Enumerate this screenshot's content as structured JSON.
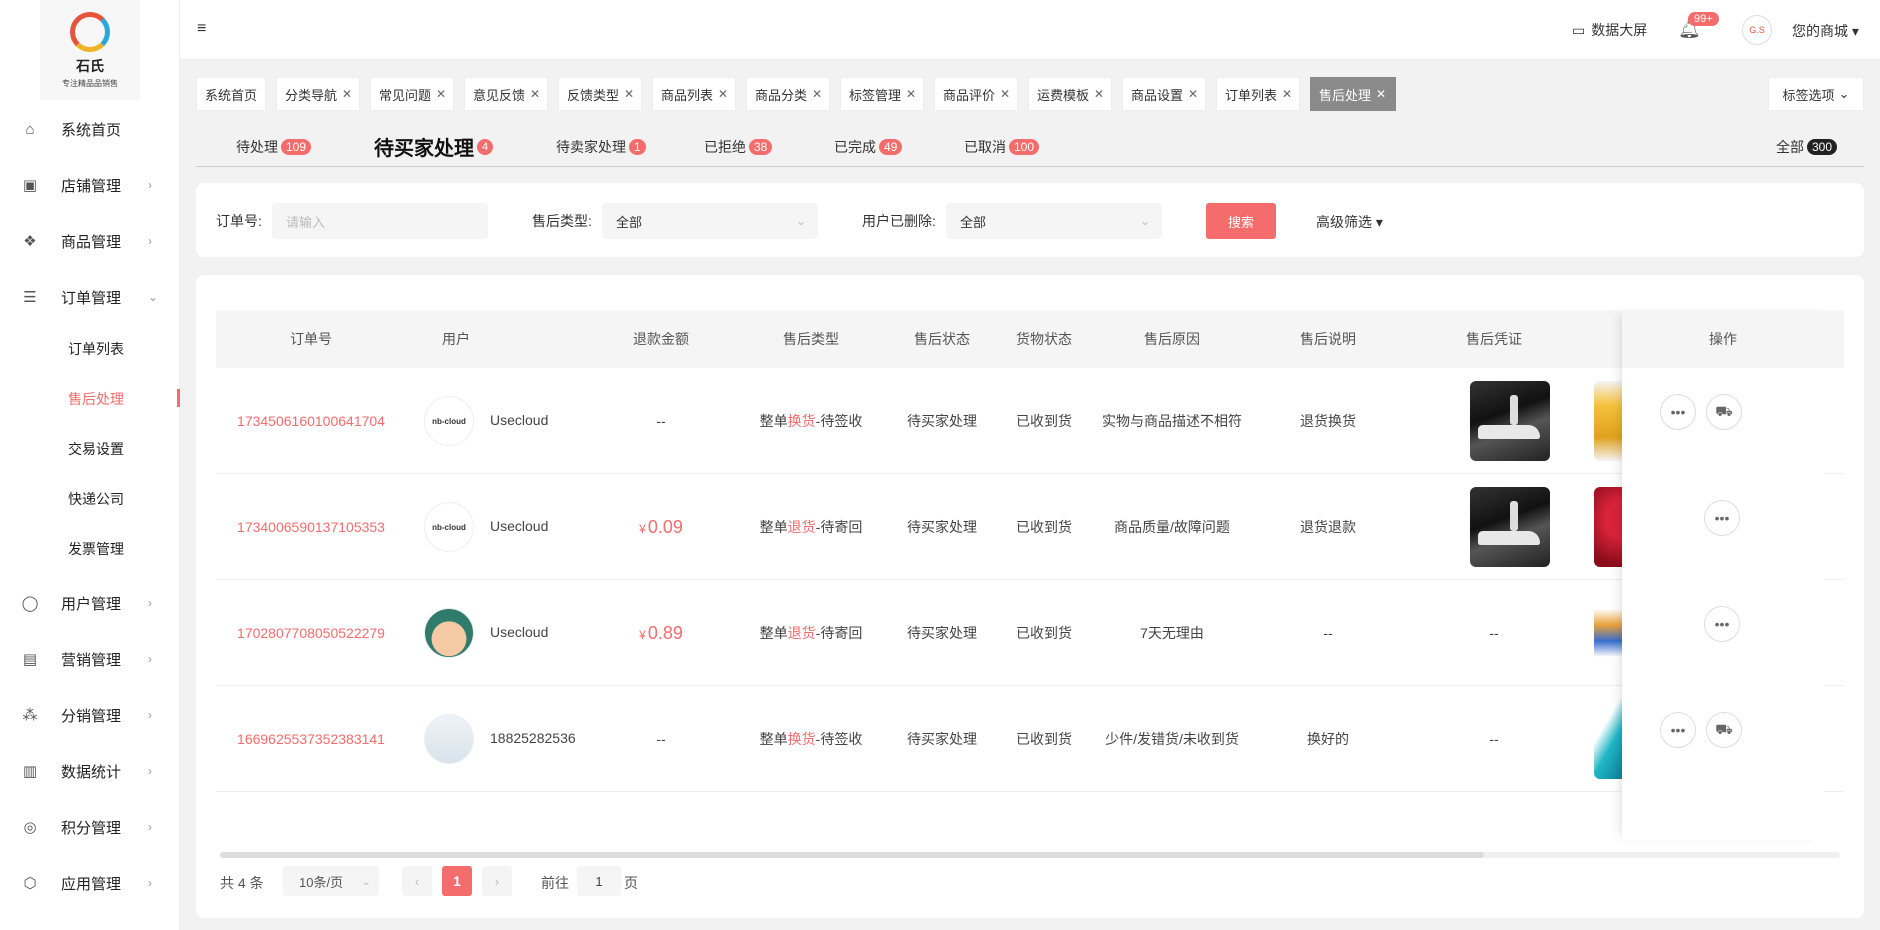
{
  "brand": {
    "name": "石氏",
    "subtitle": "专注精品品销售"
  },
  "menu": [
    {
      "label": "系统首页",
      "icon": "home-icon",
      "glyph": "⌂"
    },
    {
      "label": "店铺管理",
      "icon": "store-icon",
      "glyph": "▣"
    },
    {
      "label": "商品管理",
      "icon": "goods-icon",
      "glyph": "❖"
    },
    {
      "label": "订单管理",
      "icon": "order-icon",
      "glyph": "☰"
    },
    {
      "label": "用户管理",
      "icon": "user-icon",
      "glyph": "◯"
    },
    {
      "label": "营销管理",
      "icon": "marketing-icon",
      "glyph": "▤"
    },
    {
      "label": "分销管理",
      "icon": "distribution-icon",
      "glyph": "⁂"
    },
    {
      "label": "数据统计",
      "icon": "stats-icon",
      "glyph": "▥"
    },
    {
      "label": "积分管理",
      "icon": "points-icon",
      "glyph": "◎"
    },
    {
      "label": "应用管理",
      "icon": "apps-icon",
      "glyph": "⬡"
    }
  ],
  "submenu": [
    "订单列表",
    "售后处理",
    "交易设置",
    "快递公司",
    "发票管理"
  ],
  "header": {
    "screen_label": "数据大屏",
    "notify_badge": "99+",
    "shop_label": "您的商城",
    "avatar_text": "G.S"
  },
  "tags": [
    "系统首页",
    "分类导航",
    "常见问题",
    "意见反馈",
    "反馈类型",
    "商品列表",
    "商品分类",
    "标签管理",
    "商品评价",
    "运费模板",
    "商品设置",
    "订单列表",
    "售后处理"
  ],
  "tag_options": "标签选项",
  "status_tabs": [
    {
      "label": "待处理",
      "count": "109"
    },
    {
      "label": "待买家处理",
      "count": "4"
    },
    {
      "label": "待卖家处理",
      "count": "1"
    },
    {
      "label": "已拒绝",
      "count": "38"
    },
    {
      "label": "已完成",
      "count": "49"
    },
    {
      "label": "已取消",
      "count": "100"
    },
    {
      "label": "全部",
      "count": "300"
    }
  ],
  "filters": {
    "order_label": "订单号:",
    "order_placeholder": "请输入",
    "type_label": "售后类型:",
    "type_value": "全部",
    "deleted_label": "用户已删除:",
    "deleted_value": "全部",
    "search": "搜索",
    "advanced": "高级筛选"
  },
  "columns": [
    "订单号",
    "用户",
    "退款金额",
    "售后类型",
    "售后状态",
    "货物状态",
    "售后原因",
    "售后说明",
    "售后凭证",
    "操作"
  ],
  "rows": [
    {
      "order": "1734506160100641704",
      "avatar": "nb-cloud",
      "user": "Usecloud",
      "amount": "--",
      "type_pre": "整单",
      "type_mid": "换货",
      "type_post": "-待签收",
      "status": "待买家处理",
      "goods": "已收到货",
      "reason": "实物与商品描述不相符",
      "note": "退货换货",
      "evidence": ""
    },
    {
      "order": "1734006590137105353",
      "avatar": "nb-cloud",
      "user": "Usecloud",
      "amount_symbol": "¥",
      "amount": "0.09",
      "type_pre": "整单",
      "type_mid": "退货",
      "type_post": "-待寄回",
      "status": "待买家处理",
      "goods": "已收到货",
      "reason": "商品质量/故障问题",
      "note": "退货退款",
      "evidence": ""
    },
    {
      "order": "1702807708050522279",
      "avatar": "",
      "user": "Usecloud",
      "amount_symbol": "¥",
      "amount": "0.89",
      "type_pre": "整单",
      "type_mid": "退货",
      "type_post": "-待寄回",
      "status": "待买家处理",
      "goods": "已收到货",
      "reason": "7天无理由",
      "note": "--",
      "evidence": "--"
    },
    {
      "order": "1669625537352383141",
      "avatar": "",
      "user": "18825282536",
      "amount": "--",
      "type_pre": "整单",
      "type_mid": "换货",
      "type_post": "-待签收",
      "status": "待买家处理",
      "goods": "已收到货",
      "reason": "少件/发错货/未收到货",
      "note": "换好的",
      "evidence": "--"
    }
  ],
  "pagination": {
    "total": "共 4 条",
    "page_size": "10条/页",
    "current": "1",
    "goto_pre": "前往",
    "goto_value": "1",
    "goto_post": "页"
  }
}
